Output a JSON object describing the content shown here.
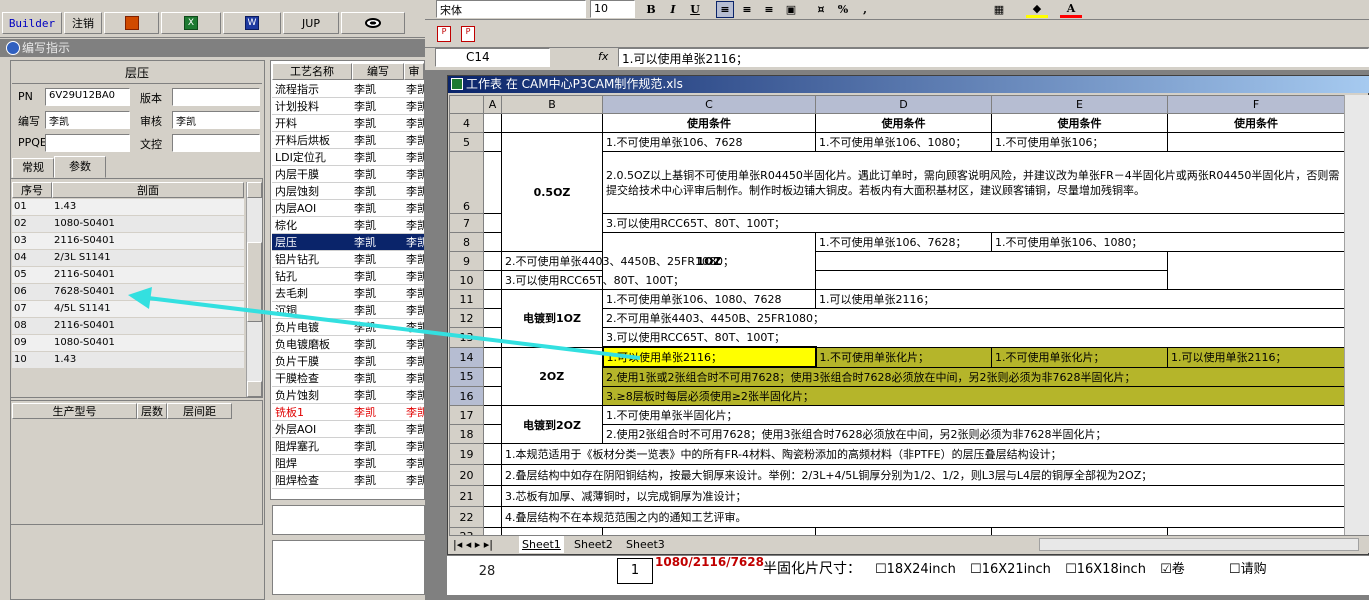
{
  "toolbar": {
    "builder": "Builder",
    "logout": "注销",
    "jup": "JUP"
  },
  "panel": {
    "title": "编写指示",
    "section": "层压",
    "fields": {
      "pn_label": "PN",
      "pn": "6V29U12BA0",
      "version_label": "版本",
      "version": "",
      "writer_label": "编写",
      "writer": "李凯",
      "review_label": "审核",
      "review": "李凯",
      "ppqe_label": "PPQE",
      "ppqe": "",
      "control_label": "文控",
      "control": ""
    },
    "tabs": [
      "常规",
      "参数"
    ],
    "grid_headers": [
      "序号",
      "剖面"
    ],
    "grid_rows": [
      [
        "01",
        "1.43"
      ],
      [
        "02",
        "1080-S0401"
      ],
      [
        "03",
        "2116-S0401"
      ],
      [
        "04",
        "2/3L S1141"
      ],
      [
        "05",
        "2116-S0401"
      ],
      [
        "06",
        "7628-S0401"
      ],
      [
        "07",
        "4/5L S1141"
      ],
      [
        "08",
        "2116-S0401"
      ],
      [
        "09",
        "1080-S0401"
      ],
      [
        "10",
        "1.43"
      ]
    ],
    "bottom_headers": [
      "生产型号",
      "层数",
      "层间距"
    ]
  },
  "process": {
    "headers": [
      "工艺名称",
      "编写",
      "审"
    ],
    "rows": [
      [
        "流程指示",
        "李凯",
        "李凯"
      ],
      [
        "计划投料",
        "李凯",
        "李凯"
      ],
      [
        "开料",
        "李凯",
        "李凯"
      ],
      [
        "开料后烘板",
        "李凯",
        "李凯"
      ],
      [
        "LDI定位孔",
        "李凯",
        "李凯"
      ],
      [
        "内层干膜",
        "李凯",
        "李凯"
      ],
      [
        "内层蚀刻",
        "李凯",
        "李凯"
      ],
      [
        "内层AOI",
        "李凯",
        "李凯"
      ],
      [
        "棕化",
        "李凯",
        "李凯"
      ],
      [
        "层压",
        "李凯",
        "李凯"
      ],
      [
        "铝片钻孔",
        "李凯",
        "李凯"
      ],
      [
        "钻孔",
        "李凯",
        "李凯"
      ],
      [
        "去毛刺",
        "李凯",
        "李凯"
      ],
      [
        "沉铜",
        "李凯",
        "李凯"
      ],
      [
        "负片电镀",
        "李凯",
        "李凯"
      ],
      [
        "负电镀磨板",
        "李凯",
        "李凯"
      ],
      [
        "负片干膜",
        "李凯",
        "李凯"
      ],
      [
        "干膜检查",
        "李凯",
        "李凯"
      ],
      [
        "负片蚀刻",
        "李凯",
        "李凯"
      ],
      [
        "铣板1",
        "李凯",
        "李凯"
      ],
      [
        "外层AOI",
        "李凯",
        "李凯"
      ],
      [
        "阻焊塞孔",
        "李凯",
        "李凯"
      ],
      [
        "阻焊",
        "李凯",
        "李凯"
      ],
      [
        "阻焊检查",
        "李凯",
        "李凯"
      ]
    ]
  },
  "excel": {
    "font": "宋体",
    "size": "10",
    "cellref": "C14",
    "formula": "1.可以使用单张2116；",
    "window_title": "工作表 在 CAM中心P3CAM制作规范.xls",
    "cols": [
      "A",
      "B",
      "C",
      "D",
      "E",
      "F"
    ],
    "rows": {
      "r4": [
        "使用条件",
        "使用条件",
        "使用条件",
        "使用条件"
      ],
      "r5": [
        "1.不可使用单张106、7628",
        "1.不可使用单张106、1080；",
        "1.不可使用单张106；"
      ],
      "r6": "2.0.5OZ以上基铜不可使用单张R04450半固化片。遇此订单时，需向顾客说明风险，并建议改为单张FR－4半固化片或两张R04450半固化片，否则需提交给技术中心评审后制作。制作时板边铺大铜皮。若板内有大面积基材区，建议顾客铺铜，尽量增加残铜率。",
      "r7": "3.可以使用RCC65T、80T、100T；",
      "b_05": "0.5OZ",
      "r8": [
        "1.不可使用单张106、7628；",
        "1.不可使用单张106、1080；"
      ],
      "r9": "2.不可使用单张4403、4450B、25FR1080；",
      "r10": "3.可以使用RCC65T、80T、100T；",
      "b_1": "1OZ",
      "r11": [
        "1.不可使用单张106、1080、7628",
        "1.可以使用单张2116；"
      ],
      "r12": "2.不可用单张4403、4450B、25FR1080；",
      "r13": "3.可以使用RCC65T、80T、100T；",
      "b_p1": "电镀到1OZ",
      "r14": [
        "1.可以使用单张2116；",
        "1.不可使用单张化片；",
        "1.不可使用单张化片；",
        "1.可以使用单张2116；"
      ],
      "r15": "2.使用1张或2张组合时不可用7628；使用3张组合时7628必须放在中间，另2张则必须为非7628半固化片；",
      "r16": "3.≥8层板时每层必须使用≥2张半固化片；",
      "b_2": "2OZ",
      "r17": "1.不可使用单张半固化片；",
      "r18": "2.使用2张组合时不可用7628；使用3张组合时7628必须放在中间，另2张则必须为非7628半固化片；",
      "b_p2": "电镀到2OZ",
      "r19": "1.本规范适用于《板材分类一览表》中的所有FR-4材料、陶瓷粉添加的高频材料（非PTFE）的层压叠层结构设计；",
      "r20": "2.叠层结构中如存在阴阳铜结构，按最大铜厚来设计。举例：2/3L+4/5L铜厚分别为1/2、1/2，则L3层与L4层的铜厚全部视为2OZ；",
      "r21": "3.芯板有加厚、减薄铜时，以完成铜厚为准设计；",
      "r22": "4.叠层结构不在本规范范围之内的通知工艺评审。",
      "sheets": [
        "Sheet1",
        "Sheet2",
        "Sheet3"
      ],
      "back_row": "28",
      "back_num": "1",
      "back_text": "1080/2116/7628",
      "back_label": "半固化片尺寸：",
      "opts": [
        "18X24inch",
        "16X21inch",
        "16X18inch",
        "卷",
        "请购"
      ]
    }
  },
  "colors": {
    "arrow": "#33e0e0",
    "selection": "#b5b52a",
    "title": "#0a246a"
  }
}
